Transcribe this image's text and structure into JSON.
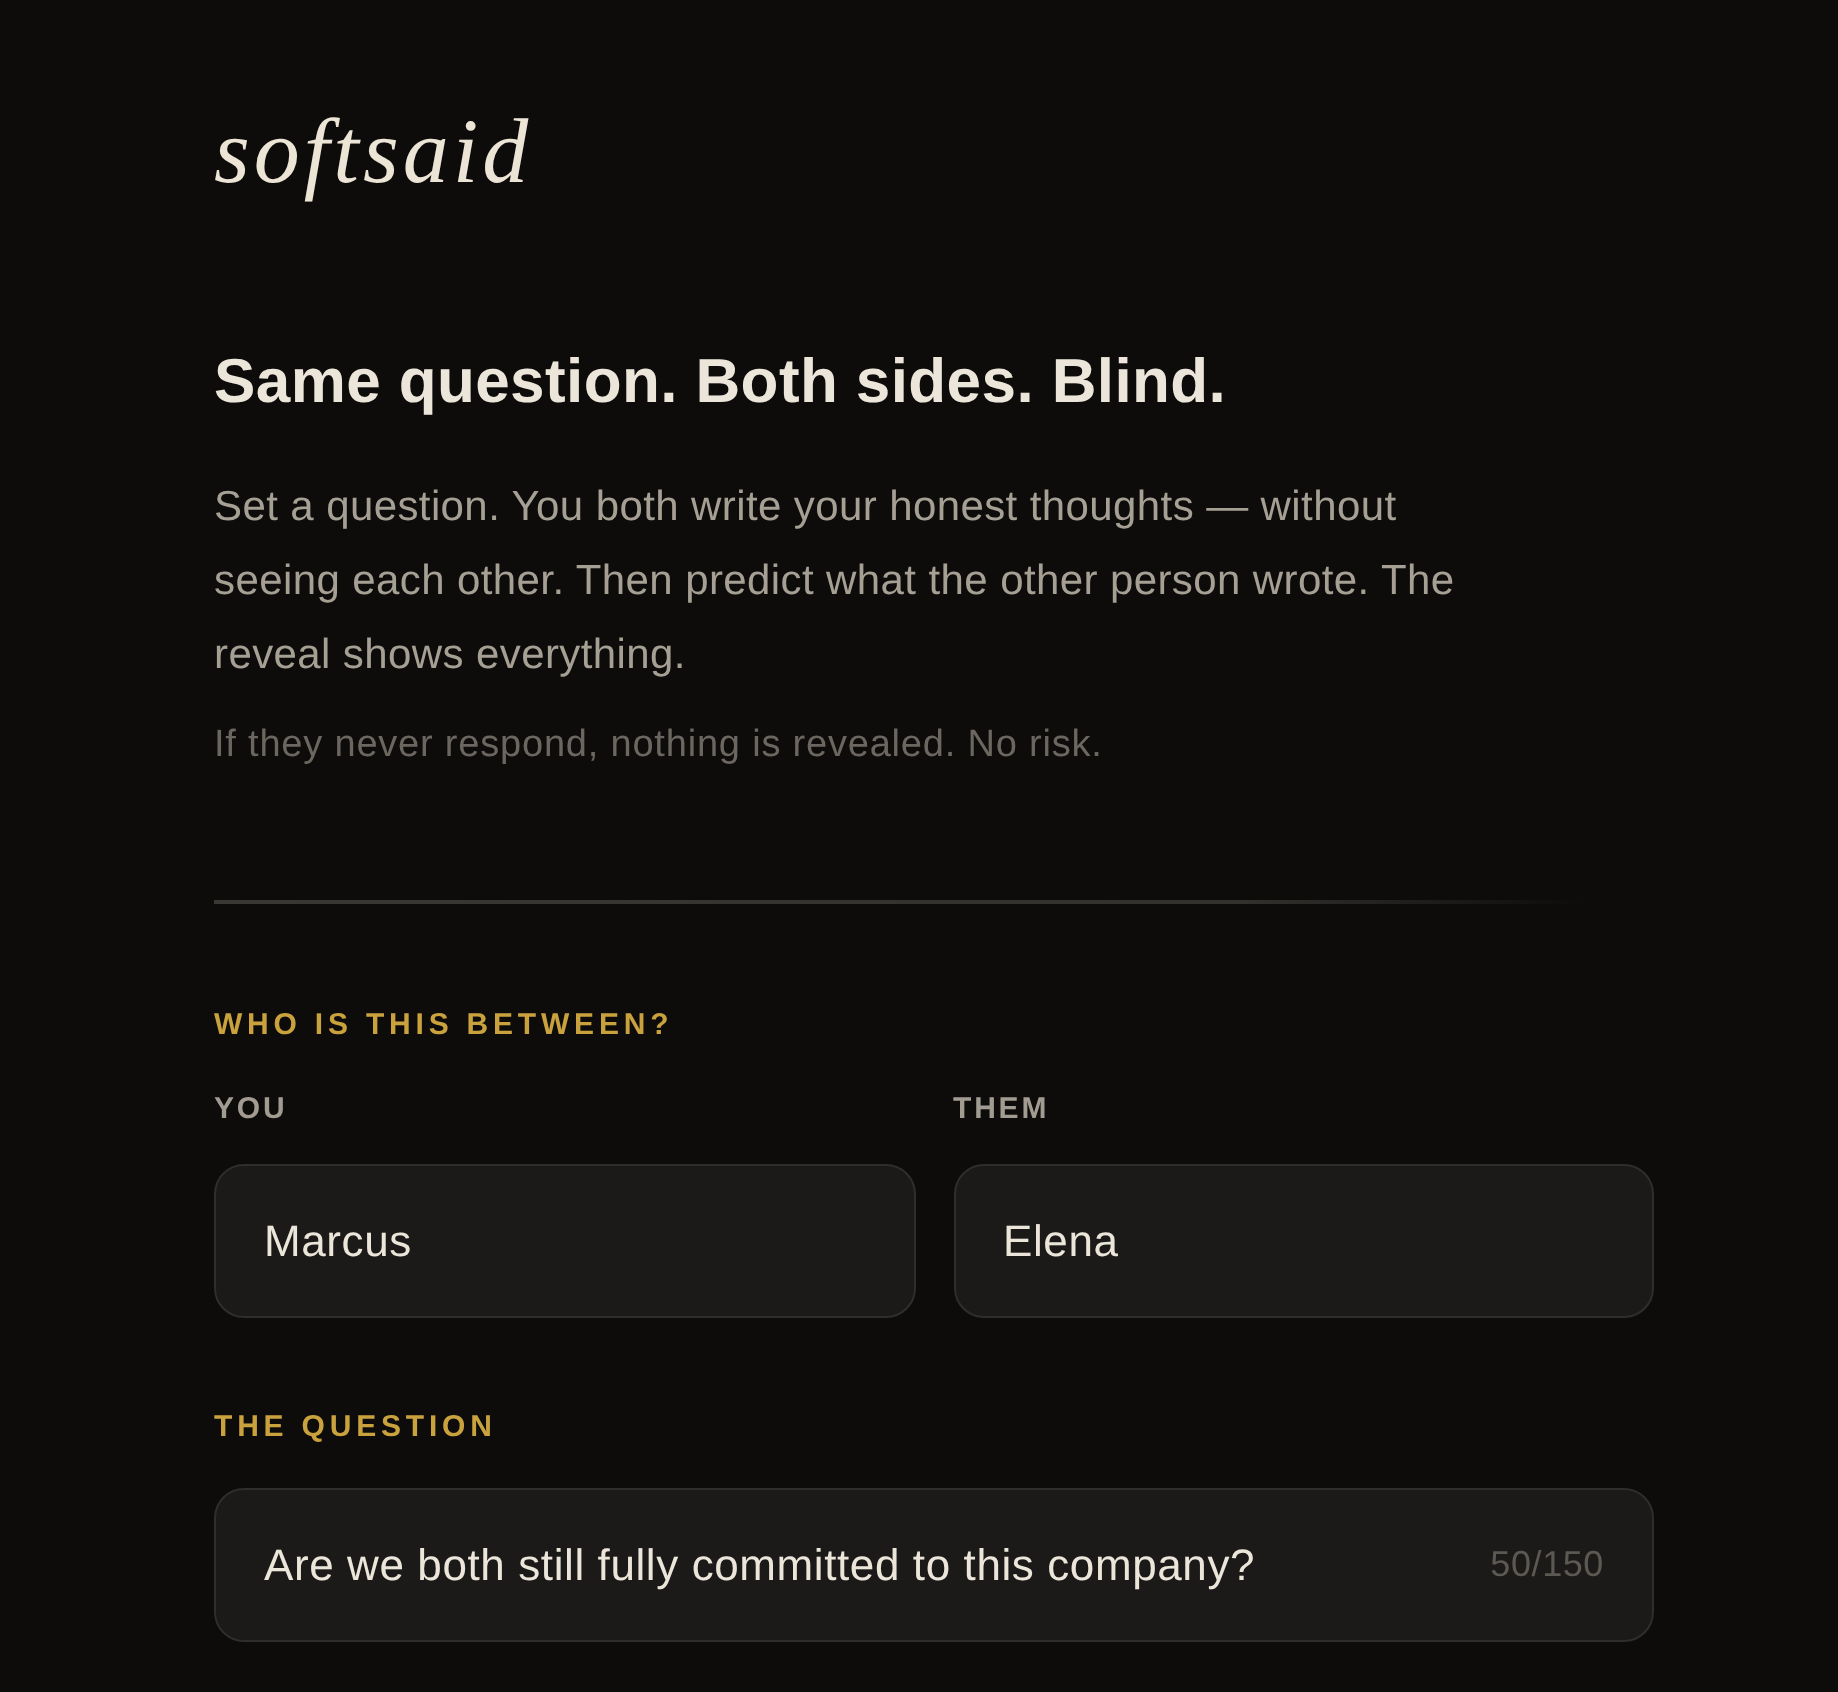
{
  "logo": "softsaid",
  "intro": {
    "heading": "Same question. Both sides. Blind.",
    "body": "Set a question. You both write your honest thoughts — without seeing each other. Then predict what the other person wrote. The reveal shows everything.",
    "note": "If they never respond, nothing is revealed. No risk."
  },
  "participants": {
    "label": "WHO IS THIS BETWEEN?",
    "fields": [
      {
        "label": "YOU",
        "value": "Marcus"
      },
      {
        "label": "THEM",
        "value": "Elena"
      }
    ]
  },
  "question": {
    "label": "THE QUESTION",
    "value": "Are we both still fully committed to this company?",
    "counter": "50/150"
  }
}
